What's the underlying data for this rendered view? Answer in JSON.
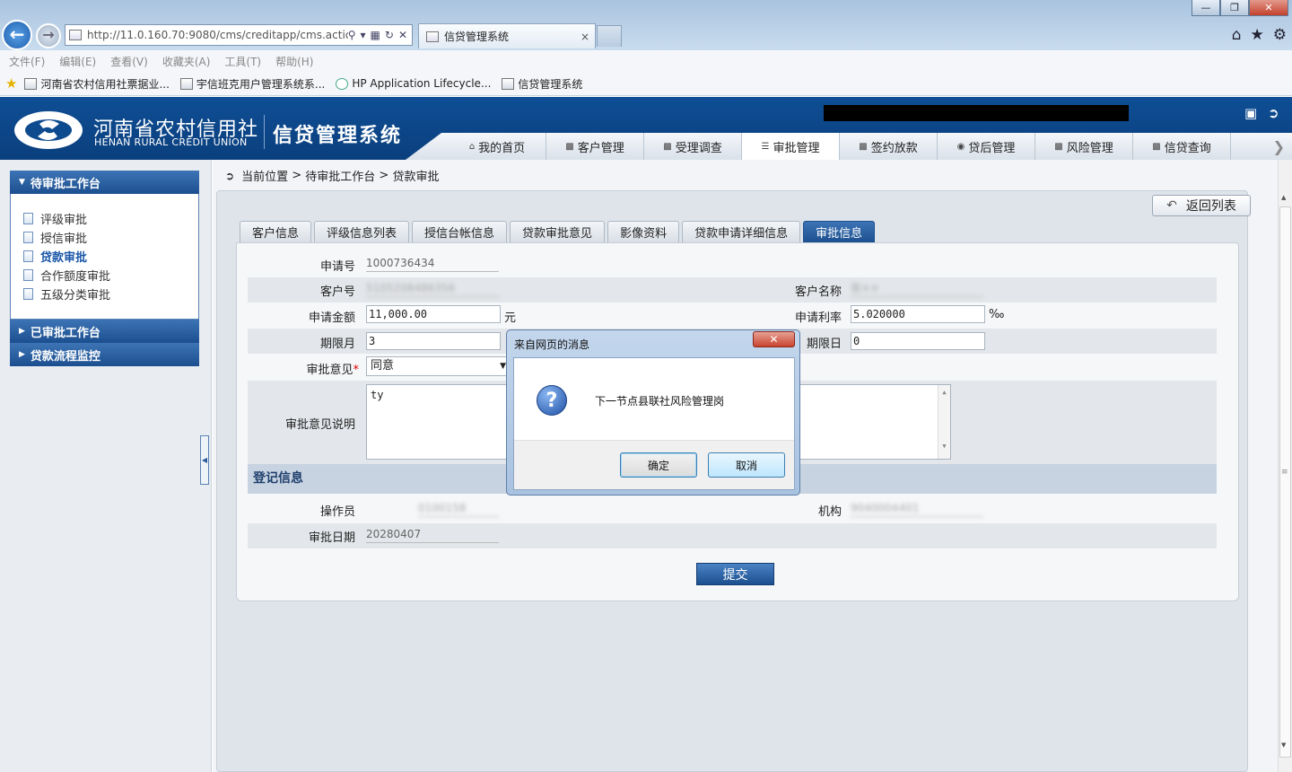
{
  "browser": {
    "address": "http://11.0.160.70:9080/cms/creditapp/cms.actic",
    "tab_title": "信贷管理系统",
    "tab_close": "×",
    "window_buttons": [
      "—",
      "❐",
      "✕"
    ],
    "menu": [
      "文件(F)",
      "编辑(E)",
      "查看(V)",
      "收藏夹(A)",
      "工具(T)",
      "帮助(H)"
    ],
    "favorites": [
      "河南省农村信用社票据业...",
      "宇信班克用户管理系统系...",
      "HP Application Lifecycle...",
      "信贷管理系统"
    ]
  },
  "header": {
    "org_name": "河南省农村信用社",
    "org_name_en": "HENAN RURAL CREDIT UNION",
    "system_name": "信贷管理系统",
    "nav": [
      {
        "label": "我的首页",
        "icon": "home-icon"
      },
      {
        "label": "客户管理",
        "icon": "customer-icon"
      },
      {
        "label": "受理调查",
        "icon": "survey-icon"
      },
      {
        "label": "审批管理",
        "icon": "approval-icon"
      },
      {
        "label": "签约放款",
        "icon": "contract-icon"
      },
      {
        "label": "贷后管理",
        "icon": "postloan-icon"
      },
      {
        "label": "风险管理",
        "icon": "risk-icon"
      },
      {
        "label": "信贷查询",
        "icon": "query-icon"
      }
    ],
    "active_nav": "审批管理"
  },
  "sidebar": {
    "section1": "待审批工作台",
    "items": [
      "评级审批",
      "授信审批",
      "贷款审批",
      "合作额度审批",
      "五级分类审批"
    ],
    "active_item": "贷款审批",
    "section2": "已审批工作台",
    "section3": "贷款流程监控"
  },
  "breadcrumb": {
    "l1": "当前位置",
    "sep": ">",
    "l2": "待审批工作台",
    "l3": "贷款审批"
  },
  "return_button": "返回列表",
  "tabs": [
    "客户信息",
    "评级信息列表",
    "授信台帐信息",
    "贷款审批意见",
    "影像资料",
    "贷款申请详细信息",
    "审批信息"
  ],
  "active_tab": "审批信息",
  "form": {
    "app_no_label": "申请号",
    "app_no": "1000736434",
    "cust_no_label": "客户号",
    "cust_no": "5105208486356",
    "cust_name_label": "客户名称",
    "cust_name": "张××",
    "amount_label": "申请金额",
    "amount": "11,000.00",
    "amount_unit": "元",
    "rate_label": "申请利率",
    "rate": "5.020000",
    "rate_unit": "‰",
    "term_month_label": "期限月",
    "term_month": "3",
    "term_day_label": "期限日",
    "term_day": "0",
    "opinion_label": "审批意见",
    "opinion_required": "*",
    "opinion": "同意",
    "opinion_desc_label": "审批意见说明",
    "opinion_desc": "ty",
    "reg_section": "登记信息",
    "operator_label": "操作员",
    "operator": "0100158",
    "org_label": "机构",
    "org": "9040004401",
    "date_label": "审批日期",
    "date": "20280407",
    "submit": "提交"
  },
  "dialog": {
    "title": "来自网页的消息",
    "close": "✕",
    "message": "下一节点县联社风险管理岗",
    "ok": "确定",
    "cancel": "取消"
  }
}
